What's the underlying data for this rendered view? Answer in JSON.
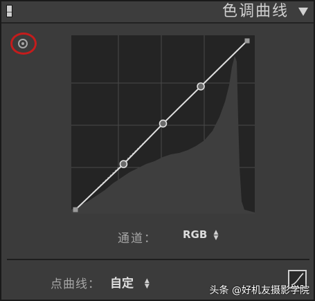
{
  "header": {
    "title": "色调曲线",
    "panel_switch_icon": "panel-toggle-icon",
    "collapse_icon": "triangle-down-icon"
  },
  "toolbar": {
    "targeted_adjustment_icon": "target-adjust-icon",
    "highlight_color": "#c41c1c"
  },
  "curve": {
    "control_points": [
      {
        "input": 0,
        "output": 0
      },
      {
        "input": 0.28,
        "output": 0.27
      },
      {
        "input": 0.51,
        "output": 0.51
      },
      {
        "input": 0.73,
        "output": 0.73
      },
      {
        "input": 1,
        "output": 1
      }
    ],
    "grid_divisions": 4,
    "line_color": "#e0e0e0"
  },
  "channel": {
    "label": "通道：",
    "value": "RGB"
  },
  "point_curve": {
    "label": "点曲线：",
    "value": "自定"
  },
  "watermark": "头条 @好机友摄影学院"
}
